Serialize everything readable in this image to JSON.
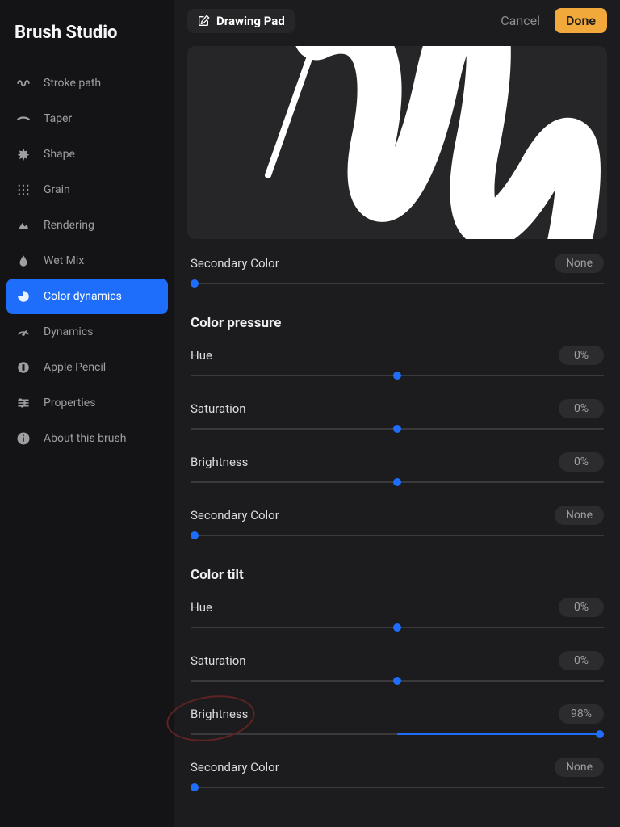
{
  "colors": {
    "accent": "#1f6dfb",
    "done": "#f0a93a"
  },
  "sidebar": {
    "title": "Brush Studio",
    "items": [
      {
        "label": "Stroke path"
      },
      {
        "label": "Taper"
      },
      {
        "label": "Shape"
      },
      {
        "label": "Grain"
      },
      {
        "label": "Rendering"
      },
      {
        "label": "Wet Mix"
      },
      {
        "label": "Color dynamics"
      },
      {
        "label": "Dynamics"
      },
      {
        "label": "Apple Pencil"
      },
      {
        "label": "Properties"
      },
      {
        "label": "About this brush"
      }
    ],
    "active_index": 6
  },
  "topbar": {
    "pad_label": "Drawing Pad",
    "cancel": "Cancel",
    "done": "Done"
  },
  "sliders_top": {
    "secondary_color": {
      "label": "Secondary Color",
      "value": "None",
      "thumb_pct": 1,
      "fill_from": 0,
      "fill_to": 1
    }
  },
  "section_pressure": {
    "title": "Color pressure",
    "hue": {
      "label": "Hue",
      "value": "0%",
      "thumb_pct": 50,
      "bipolar": true
    },
    "saturation": {
      "label": "Saturation",
      "value": "0%",
      "thumb_pct": 50,
      "bipolar": true
    },
    "brightness": {
      "label": "Brightness",
      "value": "0%",
      "thumb_pct": 50,
      "bipolar": true
    },
    "secondary_color": {
      "label": "Secondary Color",
      "value": "None",
      "thumb_pct": 1,
      "fill_from": 0,
      "fill_to": 1
    }
  },
  "section_tilt": {
    "title": "Color tilt",
    "hue": {
      "label": "Hue",
      "value": "0%",
      "thumb_pct": 50,
      "bipolar": true
    },
    "saturation": {
      "label": "Saturation",
      "value": "0%",
      "thumb_pct": 50,
      "bipolar": true
    },
    "brightness": {
      "label": "Brightness",
      "value": "98%",
      "thumb_pct": 99,
      "fill_from": 50,
      "fill_to": 99
    },
    "secondary_color": {
      "label": "Secondary Color",
      "value": "None",
      "thumb_pct": 1,
      "fill_from": 0,
      "fill_to": 1
    }
  }
}
